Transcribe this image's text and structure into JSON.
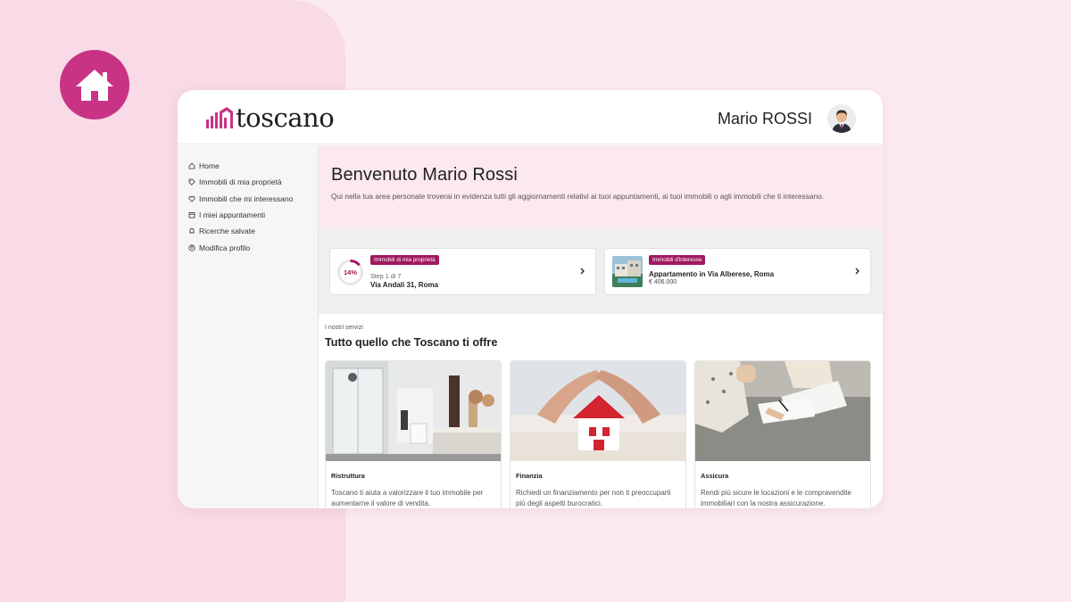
{
  "colors": {
    "accent": "#c83385",
    "tag": "#a0195f",
    "hero_bg": "#fbe8f1"
  },
  "app": {
    "logo_text": "toscano",
    "logo_icon": "bars-house-logo"
  },
  "user": {
    "name": "Mario ROSSI",
    "avatar_icon": "user-avatar"
  },
  "sidebar": {
    "items": [
      {
        "icon": "home-icon",
        "label": "Home"
      },
      {
        "icon": "tag-icon",
        "label": "Immobili di mia proprietà"
      },
      {
        "icon": "heart-icon",
        "label": "Immobili che mi interessano"
      },
      {
        "icon": "calendar-icon",
        "label": "I miei appuntamenti"
      },
      {
        "icon": "bell-icon",
        "label": "Ricerche salvate"
      },
      {
        "icon": "user-circle-icon",
        "label": "Modifica profilo"
      }
    ]
  },
  "hero": {
    "title": "Benvenuto Mario Rossi",
    "text": "Qui nella tua area personale troverai in evidenza tutti gli aggiornamenti relativi ai tuoi appuntamenti, ai tuoi immobili o agli immobili che ti interessano."
  },
  "cards": {
    "owned": {
      "progress_label": "14%",
      "progress_value": 0.14,
      "tag": "Immobili di mia proprietà",
      "step": "Step 1 di 7",
      "address": "Via Andali 31, Roma"
    },
    "interest": {
      "tag": "Immobili d'interesse",
      "title": "Appartamento in Via Alberese, Roma",
      "price": "€ 406.000"
    }
  },
  "services": {
    "eyebrow": "I nostri servizi",
    "title": "Tutto quello che Toscano ti offre",
    "items": [
      {
        "name": "Ristruttura",
        "desc": "Toscano ti aiuta a valorizzare il tuo immobile per aumentarne il valore di vendita."
      },
      {
        "name": "Finanzia",
        "desc": "Richiedi un finanziamento per non ti preoccuparti più degli aspetti burocratici."
      },
      {
        "name": "Assicura",
        "desc": "Rendi più sicure le locazioni e le compravendite immobiliari con la nostra assicurazione."
      }
    ]
  }
}
